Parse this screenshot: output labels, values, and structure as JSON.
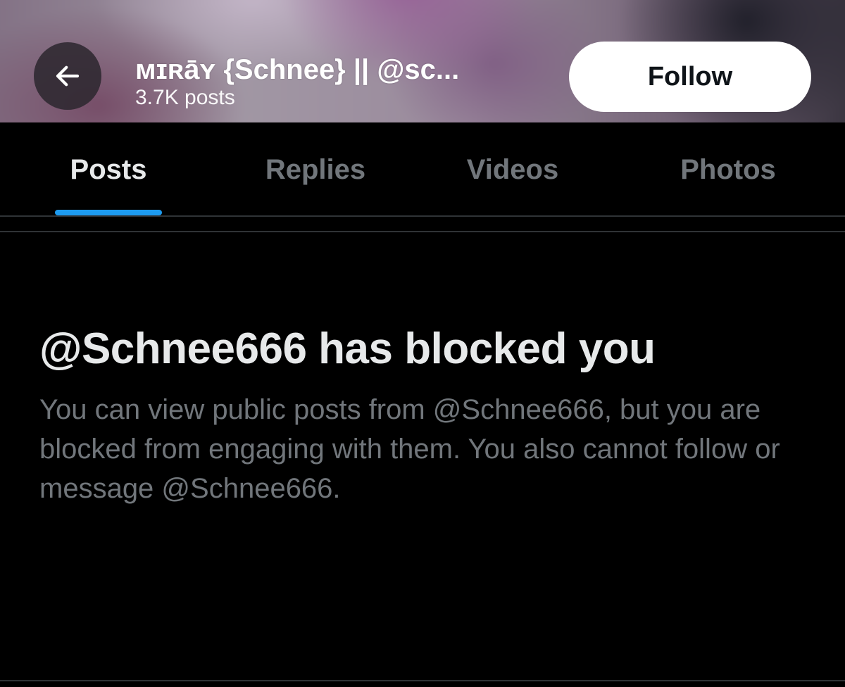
{
  "header": {
    "back_icon": "arrow-left-icon",
    "profile_name": "ᴍɪʀāʏ {Schnee} || @sc...",
    "post_count": "3.7K posts",
    "follow_label": "Follow"
  },
  "tabs": [
    {
      "label": "Posts",
      "active": true
    },
    {
      "label": "Replies",
      "active": false
    },
    {
      "label": "Videos",
      "active": false
    },
    {
      "label": "Photos",
      "active": false
    }
  ],
  "blocked": {
    "title": "@Schnee666 has blocked you",
    "description": "You can view public posts from @Schnee666, but you are blocked from engaging with them. You also cannot follow or message @Schnee666."
  },
  "colors": {
    "background": "#000000",
    "accent": "#1d9bf0",
    "primary_text": "#e7e9ea",
    "secondary_text": "#71767b",
    "follow_button_bg": "#ffffff"
  }
}
